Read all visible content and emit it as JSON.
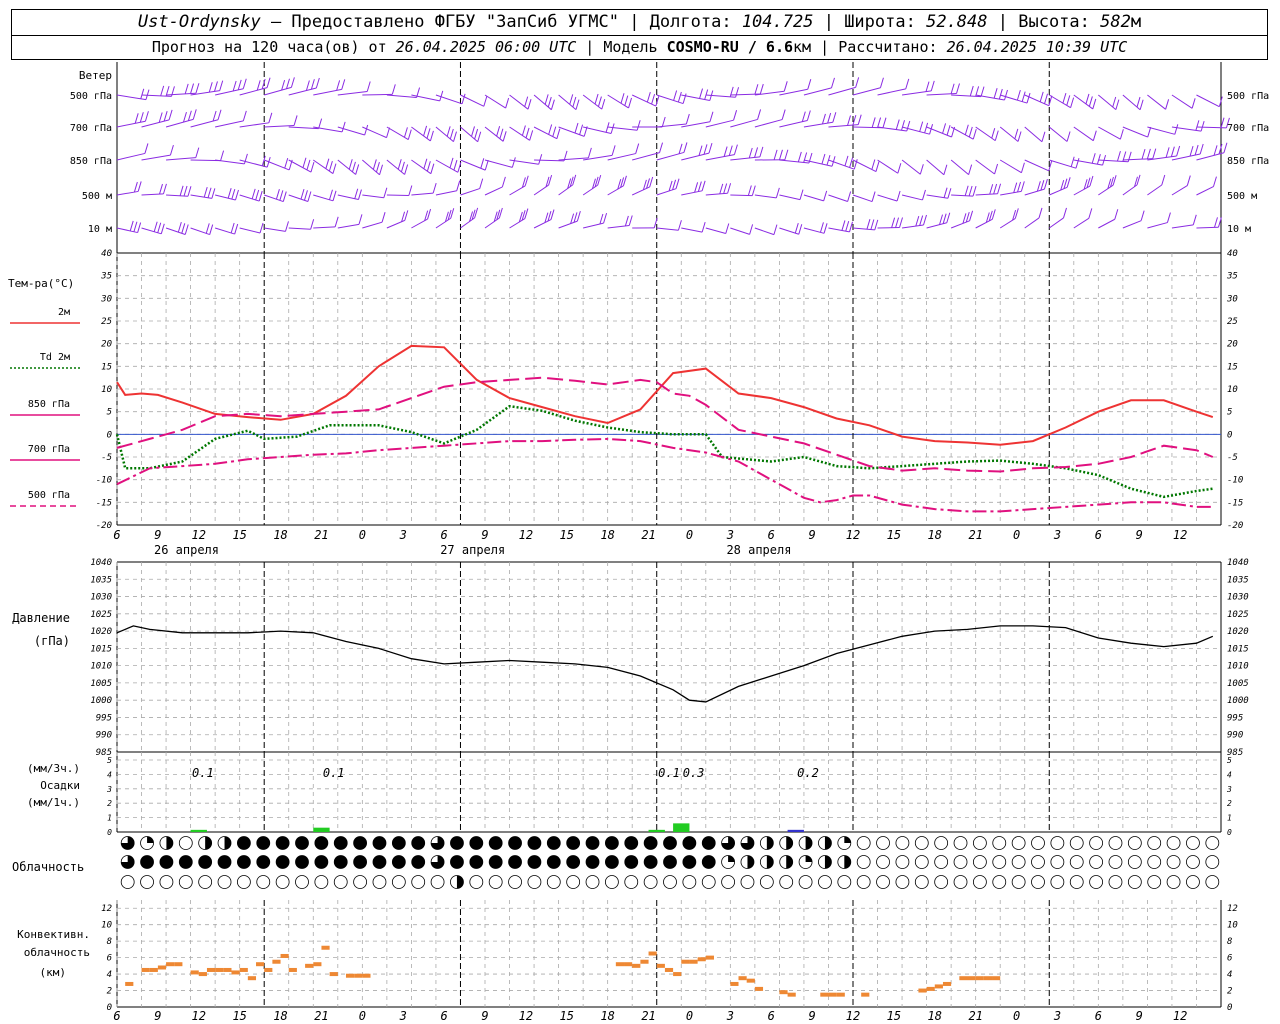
{
  "header": {
    "station": "Ust-Ordynsky",
    "provider": "— Предоставлено ФГБУ \"ЗапСиб УГМС\"",
    "lon_label": "Долгота:",
    "lon_value": "104.725",
    "lat_label": "Широта:",
    "lat_value": "52.848",
    "alt_label": "Высота:",
    "alt_value": "582",
    "alt_unit": "м",
    "forecast_label": "Прогноз на 120 часа(ов) от",
    "forecast_start": "26.04.2025 06:00 UTC",
    "model_label": "Модель",
    "model_name": "COSMO-RU / 6.6",
    "model_unit": "км",
    "calc_label": "Рассчитано:",
    "calc_time": "26.04.2025 10:39 UTC"
  },
  "labels": {
    "wind": "Ветер",
    "wind_levels": [
      "500 гПа",
      "700 гПа",
      "850 гПа",
      "500 м",
      "10 м"
    ],
    "temp_title": "Тем-ра(°С)",
    "pressure_title": "Давление",
    "pressure_unit": "(гПа)",
    "precip_unit_3h": "(мм/3ч.)",
    "precip_title": "Осадки",
    "precip_unit_1h": "(мм/1ч.)",
    "cloud_title": "Облачность",
    "conv_title1": "Конвективн.",
    "conv_title2": "облачность",
    "conv_unit": "(км)",
    "day_labels": [
      "26 апреля",
      "27 апреля",
      "28 апреля"
    ]
  },
  "colors": {
    "wind": "#8a2be2",
    "t2m": "#ee3333",
    "td2m": "#007700",
    "t850": "#e0107f",
    "t700": "#e0107f",
    "t500": "#e0107f",
    "pressure": "#000000",
    "precip_rain": "#22cc22",
    "precip_snow": "#3333cc",
    "convective": "#ee8833"
  },
  "chart_data": {
    "type": "line",
    "hours": [
      6,
      9,
      12,
      15,
      18,
      21,
      0,
      3,
      6,
      9,
      12,
      15,
      18,
      21,
      0,
      3,
      6,
      9,
      12,
      15,
      18,
      21,
      0,
      3,
      6,
      9,
      12
    ],
    "temperature": {
      "ylim": [
        -20,
        40
      ],
      "ticks": [
        40,
        35,
        30,
        25,
        20,
        15,
        10,
        5,
        0,
        -5,
        -10,
        -15,
        -20
      ],
      "series": [
        {
          "name": "2м",
          "key": "t2m",
          "style": "solid",
          "values": [
            [
              0,
              11.5
            ],
            [
              1,
              8.7
            ],
            [
              3,
              9
            ],
            [
              5,
              8.7
            ],
            [
              8,
              7
            ],
            [
              12,
              4.5
            ],
            [
              16,
              3.8
            ],
            [
              20,
              3.2
            ],
            [
              24,
              4.5
            ],
            [
              28,
              8.5
            ],
            [
              32,
              15
            ],
            [
              36,
              19.5
            ],
            [
              40,
              19.2
            ],
            [
              44,
              12
            ],
            [
              48,
              8
            ],
            [
              52,
              6
            ],
            [
              56,
              4
            ],
            [
              60,
              2.5
            ],
            [
              64,
              5.5
            ],
            [
              68,
              13.5
            ],
            [
              72,
              14.5
            ],
            [
              76,
              9
            ],
            [
              80,
              8
            ],
            [
              84,
              6
            ],
            [
              88,
              3.5
            ],
            [
              92,
              2
            ],
            [
              96,
              -0.5
            ],
            [
              100,
              -1.5
            ],
            [
              104,
              -1.8
            ],
            [
              108,
              -2.3
            ],
            [
              112,
              -1.5
            ],
            [
              116,
              1.5
            ],
            [
              120,
              5
            ],
            [
              124,
              7.5
            ],
            [
              128,
              7.5
            ],
            [
              132,
              5
            ],
            [
              134,
              3.8
            ]
          ]
        },
        {
          "name": "Td 2м",
          "key": "td2m",
          "style": "dotted",
          "values": [
            [
              0,
              0
            ],
            [
              1,
              -7.5
            ],
            [
              4,
              -7.5
            ],
            [
              8,
              -6
            ],
            [
              12,
              -1
            ],
            [
              16,
              0.8
            ],
            [
              18,
              -1
            ],
            [
              22,
              -0.5
            ],
            [
              26,
              2
            ],
            [
              32,
              2
            ],
            [
              36,
              0.5
            ],
            [
              40,
              -2
            ],
            [
              44,
              1
            ],
            [
              48,
              6.2
            ],
            [
              52,
              5.2
            ],
            [
              56,
              3
            ],
            [
              60,
              1.5
            ],
            [
              64,
              0.5
            ],
            [
              68,
              0
            ],
            [
              72,
              0
            ],
            [
              74,
              -5
            ],
            [
              80,
              -6
            ],
            [
              84,
              -5
            ],
            [
              88,
              -7
            ],
            [
              92,
              -7.5
            ],
            [
              96,
              -7
            ],
            [
              100,
              -6.5
            ],
            [
              104,
              -6
            ],
            [
              108,
              -5.8
            ],
            [
              112,
              -6.5
            ],
            [
              116,
              -7.5
            ],
            [
              120,
              -9
            ],
            [
              124,
              -12
            ],
            [
              128,
              -13.8
            ],
            [
              132,
              -12.5
            ],
            [
              134,
              -12
            ]
          ]
        },
        {
          "name": "850 гПа",
          "key": "t850",
          "style": "dashed",
          "values": [
            [
              0,
              -3
            ],
            [
              4,
              -1
            ],
            [
              8,
              1
            ],
            [
              12,
              4
            ],
            [
              16,
              4.5
            ],
            [
              20,
              4
            ],
            [
              24,
              4.5
            ],
            [
              28,
              5
            ],
            [
              32,
              5.5
            ],
            [
              36,
              8
            ],
            [
              40,
              10.5
            ],
            [
              44,
              11.5
            ],
            [
              48,
              12
            ],
            [
              52,
              12.5
            ],
            [
              56,
              11.8
            ],
            [
              60,
              11
            ],
            [
              64,
              12
            ],
            [
              66,
              11.5
            ],
            [
              68,
              9
            ],
            [
              70,
              8.5
            ],
            [
              72,
              6.5
            ],
            [
              76,
              1
            ],
            [
              80,
              -0.5
            ],
            [
              84,
              -2
            ],
            [
              88,
              -4.5
            ],
            [
              92,
              -7
            ],
            [
              96,
              -8
            ],
            [
              100,
              -7.5
            ],
            [
              104,
              -8
            ],
            [
              108,
              -8.2
            ],
            [
              112,
              -7.5
            ],
            [
              116,
              -7.2
            ],
            [
              120,
              -6.5
            ],
            [
              124,
              -5
            ],
            [
              128,
              -2.5
            ],
            [
              132,
              -3.5
            ],
            [
              134,
              -5
            ]
          ]
        },
        {
          "name": "700 гПа",
          "key": "t700",
          "style": "dashdot",
          "values": [
            [
              0,
              -11
            ],
            [
              4,
              -7.5
            ],
            [
              8,
              -7
            ],
            [
              12,
              -6.5
            ],
            [
              16,
              -5.5
            ],
            [
              20,
              -5
            ],
            [
              24,
              -4.5
            ],
            [
              28,
              -4.2
            ],
            [
              32,
              -3.5
            ],
            [
              36,
              -3
            ],
            [
              40,
              -2.5
            ],
            [
              44,
              -2
            ],
            [
              48,
              -1.5
            ],
            [
              52,
              -1.5
            ],
            [
              56,
              -1.2
            ],
            [
              60,
              -1
            ],
            [
              64,
              -1.5
            ],
            [
              68,
              -3
            ],
            [
              72,
              -4
            ],
            [
              76,
              -6
            ],
            [
              80,
              -10
            ],
            [
              84,
              -14
            ],
            [
              86,
              -15
            ],
            [
              88,
              -14.5
            ],
            [
              90,
              -13.5
            ],
            [
              92,
              -13.5
            ],
            [
              96,
              -15.5
            ],
            [
              100,
              -16.5
            ],
            [
              104,
              -17
            ],
            [
              108,
              -17
            ],
            [
              112,
              -16.5
            ],
            [
              116,
              -16
            ],
            [
              120,
              -15.5
            ],
            [
              124,
              -15
            ],
            [
              128,
              -15
            ],
            [
              132,
              -16
            ],
            [
              134,
              -16
            ]
          ]
        }
      ]
    },
    "pressure": {
      "ylim": [
        985,
        1040
      ],
      "ticks": [
        1040,
        1035,
        1030,
        1025,
        1020,
        1015,
        1010,
        1005,
        1000,
        995,
        990,
        985
      ],
      "values": [
        [
          0,
          1019.5
        ],
        [
          2,
          1021.5
        ],
        [
          4,
          1020.5
        ],
        [
          8,
          1019.5
        ],
        [
          12,
          1019.5
        ],
        [
          16,
          1019.5
        ],
        [
          20,
          1020
        ],
        [
          24,
          1019.5
        ],
        [
          28,
          1017
        ],
        [
          32,
          1015
        ],
        [
          36,
          1012
        ],
        [
          40,
          1010.5
        ],
        [
          44,
          1011
        ],
        [
          48,
          1011.5
        ],
        [
          52,
          1011
        ],
        [
          56,
          1010.5
        ],
        [
          60,
          1009.5
        ],
        [
          64,
          1007
        ],
        [
          68,
          1003
        ],
        [
          70,
          1000
        ],
        [
          72,
          999.5
        ],
        [
          76,
          1004
        ],
        [
          80,
          1007
        ],
        [
          84,
          1010
        ],
        [
          88,
          1013.5
        ],
        [
          92,
          1016
        ],
        [
          96,
          1018.5
        ],
        [
          100,
          1020
        ],
        [
          104,
          1020.5
        ],
        [
          108,
          1021.5
        ],
        [
          112,
          1021.5
        ],
        [
          116,
          1021
        ],
        [
          120,
          1018
        ],
        [
          124,
          1016.5
        ],
        [
          128,
          1015.5
        ],
        [
          132,
          1016.5
        ],
        [
          134,
          1018.5
        ]
      ]
    },
    "precipitation": {
      "ylim": [
        0,
        5
      ],
      "ticks": [
        5,
        4,
        3,
        2,
        1,
        0
      ],
      "labels": [
        {
          "x": 10.5,
          "text": "0.1"
        },
        {
          "x": 26.5,
          "text": "0.1"
        },
        {
          "x": 67.5,
          "text": "0.1"
        },
        {
          "x": 70.5,
          "text": "0.3"
        },
        {
          "x": 84.5,
          "text": "0.2"
        }
      ],
      "bars": [
        {
          "from": 9,
          "to": 11,
          "value": 0.15,
          "type": "rain"
        },
        {
          "from": 24,
          "to": 26,
          "value": 0.3,
          "type": "rain"
        },
        {
          "from": 65,
          "to": 67,
          "value": 0.15,
          "type": "rain"
        },
        {
          "from": 68,
          "to": 70,
          "value": 0.6,
          "type": "rain"
        },
        {
          "from": 82,
          "to": 84,
          "value": 0.15,
          "type": "snow"
        }
      ]
    },
    "clouds": {
      "rows": [
        "31202244444444443444444444444443322221000000000000000000000000000033444440000000000000000000000000000000000000000000000000000000000000",
        "34444444444444443444444444444441222122000000000000000000000000000003444444000000000001440000000000000000000000000000000000000000000400000",
        "00000000000000000200000000000000000000000000000000000000000000000000000400000000004444440000000000000000000000000000002300000000000000000"
      ]
    },
    "convective": {
      "ylim": [
        0,
        13
      ],
      "ticks": [
        12,
        10,
        8,
        6,
        4,
        2,
        0
      ],
      "segments": [
        {
          "x": 1,
          "y": 2.8
        },
        {
          "x": 3,
          "y": 4.5
        },
        {
          "x": 4,
          "y": 4.5
        },
        {
          "x": 5,
          "y": 4.8
        },
        {
          "x": 6,
          "y": 5.2
        },
        {
          "x": 7,
          "y": 5.2
        },
        {
          "x": 9,
          "y": 4.2
        },
        {
          "x": 10,
          "y": 4
        },
        {
          "x": 11,
          "y": 4.5
        },
        {
          "x": 12,
          "y": 4.5
        },
        {
          "x": 13,
          "y": 4.5
        },
        {
          "x": 14,
          "y": 4.2
        },
        {
          "x": 15,
          "y": 4.5
        },
        {
          "x": 16,
          "y": 3.5
        },
        {
          "x": 17,
          "y": 5.2
        },
        {
          "x": 18,
          "y": 4.5
        },
        {
          "x": 19,
          "y": 5.5
        },
        {
          "x": 20,
          "y": 6.2
        },
        {
          "x": 21,
          "y": 4.5
        },
        {
          "x": 23,
          "y": 5
        },
        {
          "x": 24,
          "y": 5.2
        },
        {
          "x": 25,
          "y": 7.2
        },
        {
          "x": 26,
          "y": 4
        },
        {
          "x": 28,
          "y": 3.8
        },
        {
          "x": 29,
          "y": 3.8
        },
        {
          "x": 30,
          "y": 3.8
        },
        {
          "x": 61,
          "y": 5.2
        },
        {
          "x": 62,
          "y": 5.2
        },
        {
          "x": 63,
          "y": 5
        },
        {
          "x": 64,
          "y": 5.5
        },
        {
          "x": 65,
          "y": 6.5
        },
        {
          "x": 66,
          "y": 5
        },
        {
          "x": 67,
          "y": 4.5
        },
        {
          "x": 68,
          "y": 4
        },
        {
          "x": 69,
          "y": 5.5
        },
        {
          "x": 70,
          "y": 5.5
        },
        {
          "x": 71,
          "y": 5.8
        },
        {
          "x": 72,
          "y": 6
        },
        {
          "x": 75,
          "y": 2.8
        },
        {
          "x": 76,
          "y": 3.5
        },
        {
          "x": 77,
          "y": 3.2
        },
        {
          "x": 78,
          "y": 2.2
        },
        {
          "x": 81,
          "y": 1.8
        },
        {
          "x": 82,
          "y": 1.5
        },
        {
          "x": 86,
          "y": 1.5
        },
        {
          "x": 87,
          "y": 1.5
        },
        {
          "x": 88,
          "y": 1.5
        },
        {
          "x": 91,
          "y": 1.5
        },
        {
          "x": 98,
          "y": 2
        },
        {
          "x": 99,
          "y": 2.2
        },
        {
          "x": 100,
          "y": 2.5
        },
        {
          "x": 101,
          "y": 2.8
        },
        {
          "x": 103,
          "y": 3.5
        },
        {
          "x": 104,
          "y": 3.5
        },
        {
          "x": 105,
          "y": 3.5
        },
        {
          "x": 106,
          "y": 3.5
        },
        {
          "x": 107,
          "y": 3.5
        }
      ]
    }
  }
}
